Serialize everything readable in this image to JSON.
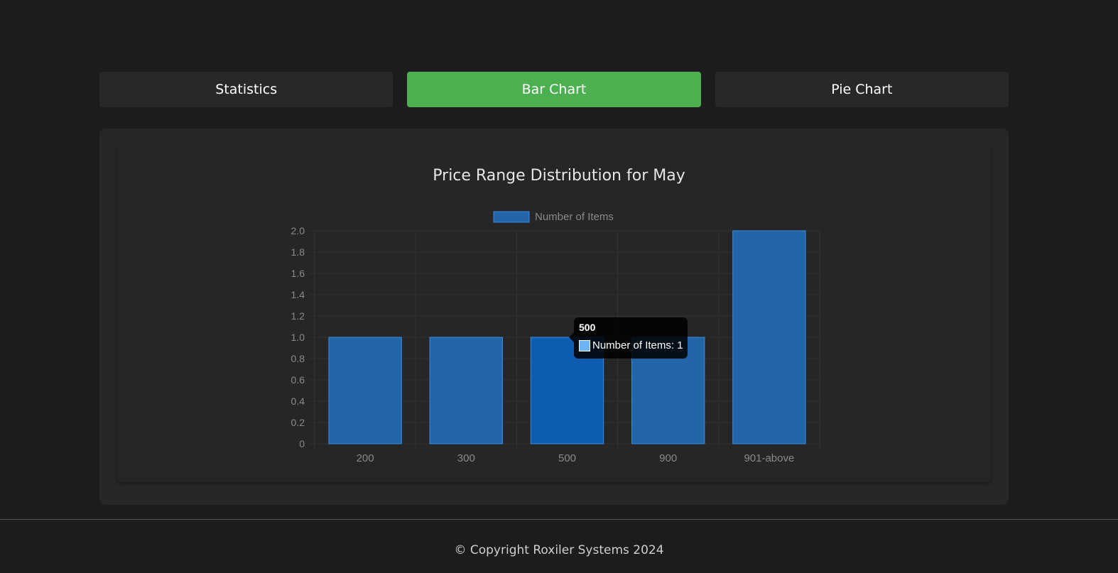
{
  "tabs": [
    {
      "label": "Statistics",
      "active": false
    },
    {
      "label": "Bar Chart",
      "active": true
    },
    {
      "label": "Pie Chart",
      "active": false
    }
  ],
  "colors": {
    "active_tab": "#4caf50",
    "bar_fill": "#2366a8",
    "bar_hover": "#0f5db0",
    "bar_border": "#3a8be0"
  },
  "tooltip": {
    "title": "500",
    "label": "Number of Items: 1"
  },
  "footer": {
    "text": "© Copyright Roxiler Systems 2024"
  },
  "chart_data": {
    "type": "bar",
    "title": "Price Range Distribution for May",
    "categories": [
      "200",
      "300",
      "500",
      "900",
      "901-above"
    ],
    "series": [
      {
        "name": "Number of Items",
        "values": [
          1,
          1,
          1,
          1,
          2
        ]
      }
    ],
    "ylim": [
      0,
      2.0
    ],
    "yticks": [
      "0",
      "0.2",
      "0.4",
      "0.6",
      "0.8",
      "1.0",
      "1.2",
      "1.4",
      "1.6",
      "1.8",
      "2.0"
    ],
    "xlabel": "",
    "ylabel": "",
    "legend": "top",
    "grid": true,
    "highlighted_category": "500"
  }
}
